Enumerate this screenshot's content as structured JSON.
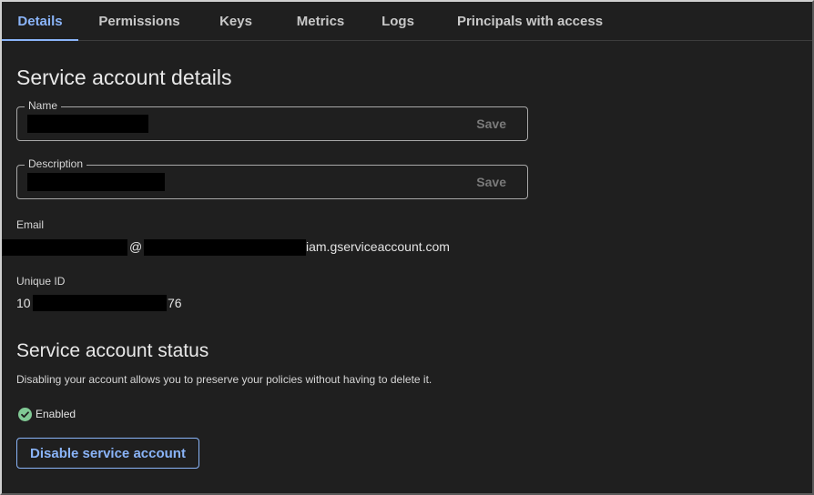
{
  "tabs": [
    {
      "label": "Details",
      "active": true
    },
    {
      "label": "Permissions",
      "active": false
    },
    {
      "label": "Keys",
      "active": false
    },
    {
      "label": "Metrics",
      "active": false
    },
    {
      "label": "Logs",
      "active": false
    },
    {
      "label": "Principals with access",
      "active": false
    }
  ],
  "details": {
    "title": "Service account details",
    "name_field": {
      "legend": "Name",
      "value": "",
      "save_label": "Save"
    },
    "description_field": {
      "legend": "Description",
      "value": "",
      "save_label": "Save"
    },
    "email": {
      "label": "Email",
      "at": "@",
      "domain": "iam.gserviceaccount.com"
    },
    "unique_id": {
      "label": "Unique ID",
      "prefix": "10",
      "suffix": "76"
    }
  },
  "status_section": {
    "title": "Service account status",
    "description": "Disabling your account allows you to preserve your policies without having to delete it.",
    "status_label": "Enabled",
    "status_icon": "check-circle-icon",
    "disable_button_label": "Disable service account"
  },
  "colors": {
    "background": "#1f1f1f",
    "accent": "#8ab4f8",
    "enabled_green": "#81c995"
  }
}
